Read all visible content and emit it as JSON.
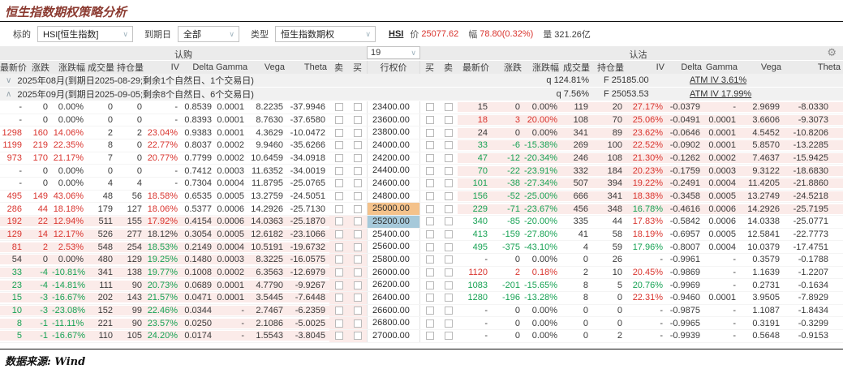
{
  "title": "恒生指数期权策略分析",
  "source": "数据来源: Wind",
  "filters": {
    "underlying_label": "标的",
    "underlying_value": "HSI[恒生指数]",
    "expiry_label": "到期日",
    "expiry_value": "全部",
    "type_label": "类型",
    "type_value": "恒生指数期权"
  },
  "quote": {
    "symbol": "HSI",
    "price_label": "价",
    "price": "25077.62",
    "change_label": "幅",
    "change": "78.80(0.32%)",
    "volume_label": "量",
    "volume": "321.26亿"
  },
  "band": {
    "calls_label": "认购",
    "puts_label": "认沽",
    "rows_count": "19"
  },
  "columns": {
    "call": [
      "最新价",
      "涨跌",
      "涨跌幅",
      "成交量",
      "持仓量",
      "IV",
      "Delta",
      "Gamma",
      "Vega",
      "Theta"
    ],
    "sell": "卖",
    "buy": "买",
    "strike": "行权价",
    "put": [
      "最新价",
      "涨跌",
      "涨跌幅",
      "成交量",
      "持仓量",
      "IV",
      "Delta",
      "Gamma",
      "Vega",
      "Theta"
    ]
  },
  "groups": [
    {
      "label": "2025年08月(到期日2025-08-29;剩余1个自然日、1个交易日)",
      "q": "q 124.81%",
      "forward": "F 25185.00",
      "atm_iv": "ATM IV 3.61%"
    },
    {
      "label": "2025年09月(到期日2025-09-05;剩余8个自然日、6个交易日)",
      "q": "q 7.56%",
      "forward": "F 25053.53",
      "atm_iv": "ATM IV 17.99%"
    }
  ],
  "colors": {
    "up": "#d9342e",
    "down": "#17a254",
    "shaded_row": "#fbebe9",
    "strike_highlight_orange": "#f4c28b",
    "strike_highlight_blue": "#a6c9da"
  },
  "rows": [
    {
      "strike": "23400.00",
      "hl": "",
      "cs": false,
      "ps": true,
      "cc": [
        "n",
        "n",
        "n"
      ],
      "pc": [
        "n",
        "n",
        "r"
      ],
      "call": [
        "-",
        "0",
        "0.00%",
        "0",
        "0",
        "-",
        "0.8539",
        "0.0001",
        "8.2235",
        "-37.9946"
      ],
      "put": [
        "15",
        "0",
        "0.00%",
        "119",
        "20",
        "27.17%",
        "-0.0379",
        "-",
        "2.9699",
        "-8.0330"
      ]
    },
    {
      "strike": "23600.00",
      "hl": "",
      "cs": false,
      "ps": true,
      "cc": [
        "n",
        "n",
        "n"
      ],
      "pc": [
        "r",
        "r",
        "r"
      ],
      "call": [
        "-",
        "0",
        "0.00%",
        "0",
        "0",
        "-",
        "0.8393",
        "0.0001",
        "8.7630",
        "-37.6580"
      ],
      "put": [
        "18",
        "3",
        "20.00%",
        "108",
        "70",
        "25.06%",
        "-0.0491",
        "0.0001",
        "3.6606",
        "-9.3073"
      ]
    },
    {
      "strike": "23800.00",
      "hl": "",
      "cs": false,
      "ps": true,
      "cc": [
        "r",
        "r",
        "r"
      ],
      "pc": [
        "n",
        "n",
        "r"
      ],
      "call": [
        "1298",
        "160",
        "14.06%",
        "2",
        "2",
        "23.04%",
        "0.9383",
        "0.0001",
        "4.3629",
        "-10.0472"
      ],
      "put": [
        "24",
        "0",
        "0.00%",
        "341",
        "89",
        "23.62%",
        "-0.0646",
        "0.0001",
        "4.5452",
        "-10.8206"
      ]
    },
    {
      "strike": "24000.00",
      "hl": "",
      "cs": false,
      "ps": true,
      "cc": [
        "r",
        "r",
        "r"
      ],
      "pc": [
        "g",
        "g",
        "r"
      ],
      "call": [
        "1199",
        "219",
        "22.35%",
        "8",
        "0",
        "22.77%",
        "0.8037",
        "0.0002",
        "9.9460",
        "-35.6266"
      ],
      "put": [
        "33",
        "-6",
        "-15.38%",
        "269",
        "100",
        "22.52%",
        "-0.0902",
        "0.0001",
        "5.8570",
        "-13.2285"
      ]
    },
    {
      "strike": "24200.00",
      "hl": "",
      "cs": false,
      "ps": true,
      "cc": [
        "r",
        "r",
        "r"
      ],
      "pc": [
        "g",
        "g",
        "r"
      ],
      "call": [
        "973",
        "170",
        "21.17%",
        "7",
        "0",
        "20.77%",
        "0.7799",
        "0.0002",
        "10.6459",
        "-34.0918"
      ],
      "put": [
        "47",
        "-12",
        "-20.34%",
        "246",
        "108",
        "21.30%",
        "-0.1262",
        "0.0002",
        "7.4637",
        "-15.9425"
      ]
    },
    {
      "strike": "24400.00",
      "hl": "",
      "cs": false,
      "ps": true,
      "cc": [
        "n",
        "n",
        "n"
      ],
      "pc": [
        "g",
        "g",
        "r"
      ],
      "call": [
        "-",
        "0",
        "0.00%",
        "0",
        "0",
        "-",
        "0.7412",
        "0.0003",
        "11.6352",
        "-34.0019"
      ],
      "put": [
        "70",
        "-22",
        "-23.91%",
        "332",
        "184",
        "20.23%",
        "-0.1759",
        "0.0003",
        "9.3122",
        "-18.6830"
      ]
    },
    {
      "strike": "24600.00",
      "hl": "",
      "cs": false,
      "ps": true,
      "cc": [
        "n",
        "n",
        "n"
      ],
      "pc": [
        "g",
        "g",
        "r"
      ],
      "call": [
        "-",
        "0",
        "0.00%",
        "4",
        "4",
        "-",
        "0.7304",
        "0.0004",
        "11.8795",
        "-25.0765"
      ],
      "put": [
        "101",
        "-38",
        "-27.34%",
        "507",
        "394",
        "19.22%",
        "-0.2491",
        "0.0004",
        "11.4205",
        "-21.8860"
      ]
    },
    {
      "strike": "24800.00",
      "hl": "",
      "cs": false,
      "ps": true,
      "cc": [
        "r",
        "r",
        "r"
      ],
      "pc": [
        "g",
        "g",
        "r"
      ],
      "call": [
        "495",
        "149",
        "43.06%",
        "48",
        "56",
        "18.58%",
        "0.6535",
        "0.0005",
        "13.2759",
        "-24.5051"
      ],
      "put": [
        "156",
        "-52",
        "-25.00%",
        "666",
        "341",
        "18.38%",
        "-0.3458",
        "0.0005",
        "13.2749",
        "-24.5218"
      ]
    },
    {
      "strike": "25000.00",
      "hl": "orange",
      "cs": false,
      "ps": true,
      "cc": [
        "r",
        "r",
        "r"
      ],
      "pc": [
        "g",
        "g",
        "g"
      ],
      "call": [
        "286",
        "44",
        "18.18%",
        "179",
        "127",
        "18.06%",
        "0.5377",
        "0.0006",
        "14.2926",
        "-25.7130"
      ],
      "put": [
        "229",
        "-71",
        "-23.67%",
        "456",
        "348",
        "16.78%",
        "-0.4616",
        "0.0006",
        "14.2926",
        "-25.7195"
      ]
    },
    {
      "strike": "25200.00",
      "hl": "blue",
      "cs": true,
      "ps": false,
      "cc": [
        "r",
        "r",
        "r"
      ],
      "pc": [
        "g",
        "g",
        "r"
      ],
      "call": [
        "192",
        "22",
        "12.94%",
        "511",
        "155",
        "17.92%",
        "0.4154",
        "0.0006",
        "14.0363",
        "-25.1870"
      ],
      "put": [
        "340",
        "-85",
        "-20.00%",
        "335",
        "44",
        "17.83%",
        "-0.5842",
        "0.0006",
        "14.0338",
        "-25.0771"
      ]
    },
    {
      "strike": "25400.00",
      "hl": "",
      "cs": true,
      "ps": false,
      "cc": [
        "r",
        "r",
        "n"
      ],
      "pc": [
        "g",
        "g",
        "r"
      ],
      "call": [
        "129",
        "14",
        "12.17%",
        "526",
        "277",
        "18.12%",
        "0.3054",
        "0.0005",
        "12.6182",
        "-23.1066"
      ],
      "put": [
        "413",
        "-159",
        "-27.80%",
        "41",
        "58",
        "18.19%",
        "-0.6957",
        "0.0005",
        "12.5841",
        "-22.7773"
      ]
    },
    {
      "strike": "25600.00",
      "hl": "",
      "cs": true,
      "ps": false,
      "cc": [
        "r",
        "r",
        "g"
      ],
      "pc": [
        "g",
        "g",
        "g"
      ],
      "call": [
        "81",
        "2",
        "2.53%",
        "548",
        "254",
        "18.53%",
        "0.2149",
        "0.0004",
        "10.5191",
        "-19.6732"
      ],
      "put": [
        "495",
        "-375",
        "-43.10%",
        "4",
        "59",
        "17.96%",
        "-0.8007",
        "0.0004",
        "10.0379",
        "-17.4751"
      ]
    },
    {
      "strike": "25800.00",
      "hl": "",
      "cs": true,
      "ps": false,
      "cc": [
        "n",
        "n",
        "g"
      ],
      "pc": [
        "n",
        "n",
        "n"
      ],
      "call": [
        "54",
        "0",
        "0.00%",
        "480",
        "129",
        "19.25%",
        "0.1480",
        "0.0003",
        "8.3225",
        "-16.0575"
      ],
      "put": [
        "-",
        "0",
        "0.00%",
        "0",
        "26",
        "-",
        "-0.9961",
        "-",
        "0.3579",
        "-0.1788"
      ]
    },
    {
      "strike": "26000.00",
      "hl": "",
      "cs": true,
      "ps": false,
      "cc": [
        "g",
        "g",
        "g"
      ],
      "pc": [
        "r",
        "r",
        "r"
      ],
      "call": [
        "33",
        "-4",
        "-10.81%",
        "341",
        "138",
        "19.77%",
        "0.1008",
        "0.0002",
        "6.3563",
        "-12.6979"
      ],
      "put": [
        "1120",
        "2",
        "0.18%",
        "2",
        "10",
        "20.45%",
        "-0.9869",
        "-",
        "1.1639",
        "-1.2207"
      ]
    },
    {
      "strike": "26200.00",
      "hl": "",
      "cs": true,
      "ps": false,
      "cc": [
        "g",
        "g",
        "g"
      ],
      "pc": [
        "g",
        "g",
        "g"
      ],
      "call": [
        "23",
        "-4",
        "-14.81%",
        "111",
        "90",
        "20.73%",
        "0.0689",
        "0.0001",
        "4.7790",
        "-9.9267"
      ],
      "put": [
        "1083",
        "-201",
        "-15.65%",
        "8",
        "5",
        "20.76%",
        "-0.9969",
        "-",
        "0.2731",
        "-0.1634"
      ]
    },
    {
      "strike": "26400.00",
      "hl": "",
      "cs": true,
      "ps": false,
      "cc": [
        "g",
        "g",
        "g"
      ],
      "pc": [
        "g",
        "g",
        "r"
      ],
      "call": [
        "15",
        "-3",
        "-16.67%",
        "202",
        "143",
        "21.57%",
        "0.0471",
        "0.0001",
        "3.5445",
        "-7.6448"
      ],
      "put": [
        "1280",
        "-196",
        "-13.28%",
        "8",
        "0",
        "22.31%",
        "-0.9460",
        "0.0001",
        "3.9505",
        "-7.8929"
      ]
    },
    {
      "strike": "26600.00",
      "hl": "",
      "cs": true,
      "ps": false,
      "cc": [
        "g",
        "g",
        "g"
      ],
      "pc": [
        "n",
        "n",
        "n"
      ],
      "call": [
        "10",
        "-3",
        "-23.08%",
        "152",
        "99",
        "22.46%",
        "0.0344",
        "-",
        "2.7467",
        "-6.2359"
      ],
      "put": [
        "-",
        "0",
        "0.00%",
        "0",
        "0",
        "-",
        "-0.9875",
        "-",
        "1.1087",
        "-1.8434"
      ]
    },
    {
      "strike": "26800.00",
      "hl": "",
      "cs": true,
      "ps": false,
      "cc": [
        "g",
        "g",
        "g"
      ],
      "pc": [
        "n",
        "n",
        "n"
      ],
      "call": [
        "8",
        "-1",
        "-11.11%",
        "221",
        "90",
        "23.57%",
        "0.0250",
        "-",
        "2.1086",
        "-5.0025"
      ],
      "put": [
        "-",
        "0",
        "0.00%",
        "0",
        "0",
        "-",
        "-0.9965",
        "-",
        "0.3191",
        "-0.3299"
      ]
    },
    {
      "strike": "27000.00",
      "hl": "",
      "cs": true,
      "ps": false,
      "cc": [
        "g",
        "g",
        "g"
      ],
      "pc": [
        "n",
        "n",
        "n"
      ],
      "call": [
        "5",
        "-1",
        "-16.67%",
        "110",
        "105",
        "24.20%",
        "0.0174",
        "-",
        "1.5543",
        "-3.8045"
      ],
      "put": [
        "-",
        "0",
        "0.00%",
        "0",
        "2",
        "-",
        "-0.9939",
        "-",
        "0.5648",
        "-0.9153"
      ]
    }
  ]
}
